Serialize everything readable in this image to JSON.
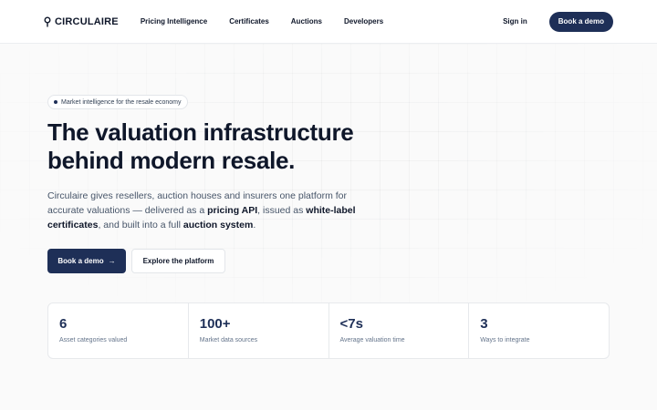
{
  "nav": {
    "brand": "CIRCULAIRE",
    "brand_icon": "pin-icon",
    "links": [
      "Pricing Intelligence",
      "Certificates",
      "Auctions",
      "Developers"
    ],
    "sign_in": "Sign in",
    "cta": "Book a demo"
  },
  "hero": {
    "pill": "Market intelligence for the resale economy",
    "headline_line1": "The valuation infrastructure",
    "headline_line2": "behind modern resale.",
    "lead": {
      "t1": "Circulaire gives resellers, auction houses and insurers one platform for accurate valuations — delivered as a ",
      "b1": "pricing API",
      "t2": ", issued as ",
      "b2": "white-label certificates",
      "t3": ", and built into a full ",
      "b3": "auction system",
      "t4": "."
    },
    "primary_cta": "Book a demo",
    "primary_cta_icon": "arrow-right-icon",
    "secondary_cta": "Explore the platform"
  },
  "stats": [
    {
      "value": "6",
      "label": "Asset categories valued"
    },
    {
      "value": "100+",
      "label": "Market data sources"
    },
    {
      "value": "<7s",
      "label": "Average valuation time"
    },
    {
      "value": "3",
      "label": "Ways to integrate"
    }
  ],
  "colors": {
    "brand_navy": "#1e2f57",
    "text_dark": "#0f172a",
    "text_muted": "#475569",
    "background": "#fafafa"
  }
}
